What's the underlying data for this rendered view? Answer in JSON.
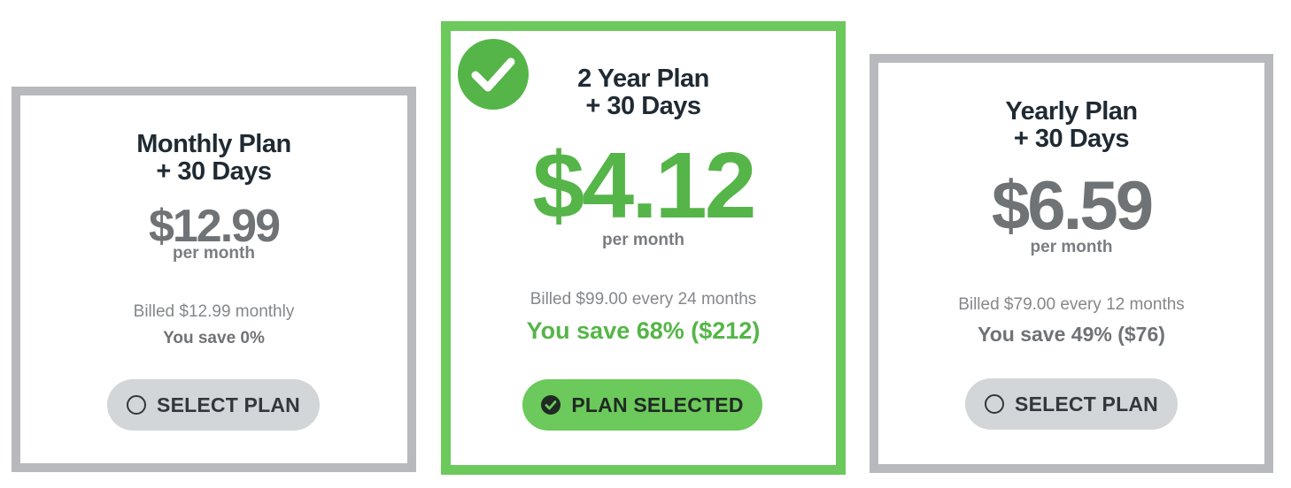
{
  "plans": [
    {
      "title_line1": "Monthly Plan",
      "title_line2": "+ 30 Days",
      "price": "$12.99",
      "per_period": "per month",
      "billed": "Billed $12.99 monthly",
      "savings": "You save 0%",
      "button_label": "SELECT PLAN",
      "button_icon": "radio-empty-icon",
      "selected": false
    },
    {
      "title_line1": "2 Year Plan",
      "title_line2": "+ 30 Days",
      "price": "$4.12",
      "per_period": "per month",
      "billed": "Billed $99.00 every 24 months",
      "savings": "You save 68% ($212)",
      "button_label": "PLAN SELECTED",
      "button_icon": "check-circle-icon",
      "selected": true
    },
    {
      "title_line1": "Yearly Plan",
      "title_line2": "+ 30 Days",
      "price": "$6.59",
      "per_period": "per month",
      "billed": "Billed $79.00 every 12 months",
      "savings": "You save 49% ($76)",
      "button_label": "SELECT PLAN",
      "button_icon": "radio-empty-icon",
      "selected": false
    }
  ],
  "selected_badge_icon": "checkmark-badge-icon",
  "colors": {
    "accent_green": "#6cc95b",
    "price_green": "#55b548",
    "border_grey": "#b8b9bd",
    "button_grey": "#d2d6d9",
    "title_dark": "#1f2a33",
    "text_grey": "#707376"
  }
}
